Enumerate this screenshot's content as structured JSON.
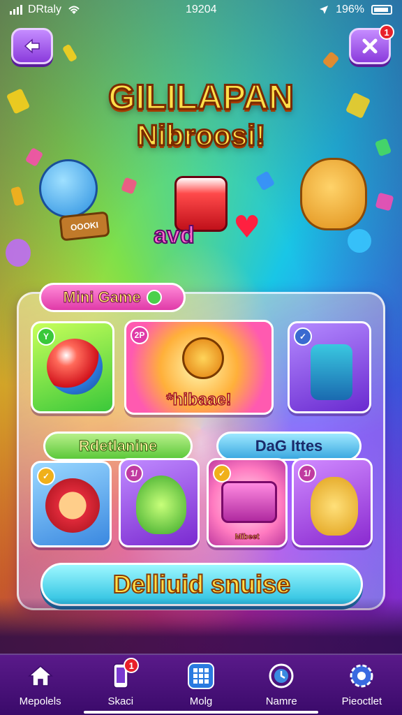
{
  "status_bar": {
    "carrier": "DRtaly",
    "time": "19204",
    "battery": "196%"
  },
  "header": {
    "back_icon": "back-arrow-icon",
    "close_icon": "close-icon",
    "close_badge": "1"
  },
  "title": {
    "line1": "GILILAPAN",
    "line2": "Nibroosi!"
  },
  "hero": {
    "sign_text": "OOOKI",
    "logo_text": "avd"
  },
  "sections": {
    "mini_game_label": "Mini Game",
    "left_label": "Rdetlanine",
    "right_label": "DaG Ittes"
  },
  "cards": {
    "ball_badge": "Y",
    "hibase_badge": "2P",
    "hibase_caption": "*hibaae!",
    "robot_badge": "✓",
    "lion_badge": "✓",
    "dino_badge": "1/",
    "chest_badge": "✓",
    "chest_caption": "Mibeet",
    "bunny_badge": "1/"
  },
  "cta": {
    "label": "Delliuid snuise"
  },
  "nav": {
    "items": [
      {
        "label": "Mepolels",
        "icon": "home-icon"
      },
      {
        "label": "Skaci",
        "icon": "phone-icon",
        "badge": "1"
      },
      {
        "label": "Molg",
        "icon": "grid-icon"
      },
      {
        "label": "Namre",
        "icon": "clock-icon"
      },
      {
        "label": "Pieoctlet",
        "icon": "gear-icon"
      }
    ]
  },
  "colors": {
    "accent_gold": "#ffe04a",
    "panel_border": "#ffffff",
    "nav_bg": "#4a1278",
    "badge_red": "#e8202a"
  }
}
